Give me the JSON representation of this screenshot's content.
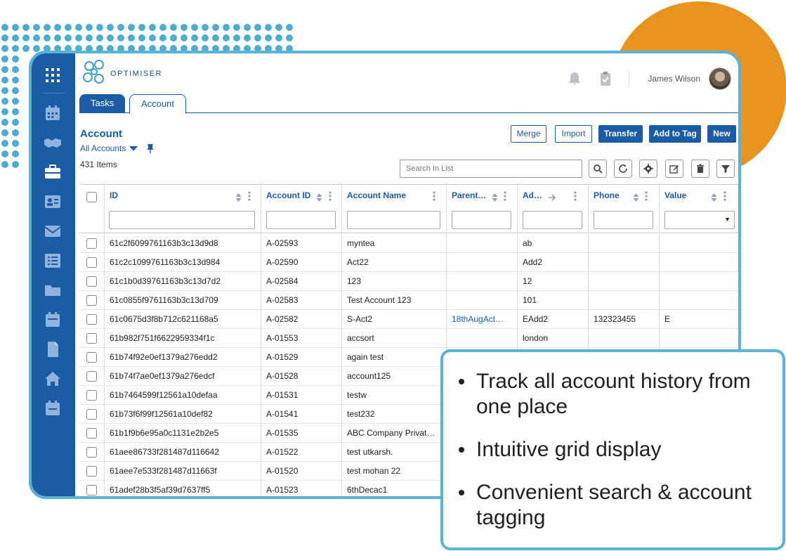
{
  "app": {
    "logo_text": "OPTIMISER",
    "user_name": "James Wilson"
  },
  "tabs": [
    {
      "label": "Tasks",
      "active": false
    },
    {
      "label": "Account",
      "active": true
    }
  ],
  "page": {
    "title": "Account",
    "view": "All Accounts",
    "item_count": "431 Items"
  },
  "actions": {
    "merge": "Merge",
    "import": "Import",
    "transfer": "Transfer",
    "add_to_tag": "Add to Tag",
    "new": "New"
  },
  "search": {
    "placeholder": "Search In List"
  },
  "toolbar_icons": [
    "search-icon",
    "refresh-icon",
    "settings-icon",
    "edit-icon",
    "delete-icon",
    "filter-icon"
  ],
  "sidebar_icons": [
    "apps-grid-icon",
    "calendar-icon",
    "handshake-icon",
    "briefcase-icon",
    "contact-card-icon",
    "mail-icon",
    "list-icon",
    "folder-icon",
    "calendar-alt-icon",
    "document-icon",
    "home-icon",
    "calendar-event-icon"
  ],
  "grid": {
    "columns": [
      "ID",
      "Account ID",
      "Account Name",
      "Parent…",
      "Ad…",
      "Phone",
      "Value"
    ],
    "rows": [
      {
        "id": "61c2f6099761163b3c13d9d8",
        "account_id": "A-02593",
        "name": "myntea",
        "parent": "",
        "address": "ab",
        "phone": "",
        "value": ""
      },
      {
        "id": "61c2c1099761163b3c13d984",
        "account_id": "A-02590",
        "name": "Act22",
        "parent": "",
        "address": "Add2",
        "phone": "",
        "value": ""
      },
      {
        "id": "61c1b0d39761163b3c13d7d2",
        "account_id": "A-02584",
        "name": "123",
        "parent": "",
        "address": "12",
        "phone": "",
        "value": ""
      },
      {
        "id": "61c0855f9761163b3c13d709",
        "account_id": "A-02583",
        "name": "Test Account 123",
        "parent": "",
        "address": "101",
        "phone": "",
        "value": ""
      },
      {
        "id": "61c0675d3f8b712c621168a5",
        "account_id": "A-02582",
        "name": "S-Act2",
        "parent": "18thAugAct…",
        "address": "EAdd2",
        "phone": "132323455",
        "value": "E"
      },
      {
        "id": "61b982f751f6622959334f1c",
        "account_id": "A-01553",
        "name": "accsort",
        "parent": "",
        "address": "london",
        "phone": "",
        "value": ""
      },
      {
        "id": "61b74f92e0ef1379a276edd2",
        "account_id": "A-01529",
        "name": "again test",
        "parent": "",
        "address": "",
        "phone": "",
        "value": ""
      },
      {
        "id": "61b74f7ae0ef1379a276edcf",
        "account_id": "A-01528",
        "name": "account125",
        "parent": "",
        "address": "",
        "phone": "",
        "value": ""
      },
      {
        "id": "61b7464599f12561a10defaa",
        "account_id": "A-01531",
        "name": "testw",
        "parent": "",
        "address": "",
        "phone": "",
        "value": ""
      },
      {
        "id": "61b73f6f99f12561a10def82",
        "account_id": "A-01541",
        "name": "test232",
        "parent": "",
        "address": "",
        "phone": "",
        "value": ""
      },
      {
        "id": "61b1f9b6e95a0c1131e2b2e5",
        "account_id": "A-01535",
        "name": "ABC Company Privat…",
        "parent": "",
        "address": "",
        "phone": "",
        "value": ""
      },
      {
        "id": "61aee86733f281487d116642",
        "account_id": "A-01522",
        "name": "test utkarsh.",
        "parent": "",
        "address": "",
        "phone": "",
        "value": ""
      },
      {
        "id": "61aee7e533f281487d11663f",
        "account_id": "A-01520",
        "name": "test mohan 22",
        "parent": "",
        "address": "",
        "phone": "",
        "value": ""
      },
      {
        "id": "61adef28b3f5af39d7637ff5",
        "account_id": "A-01523",
        "name": "6thDecac1",
        "parent": "",
        "address": "",
        "phone": "",
        "value": ""
      }
    ]
  },
  "callout": {
    "bullets": [
      "Track all account history from one place",
      "Intuitive grid display",
      "Convenient search & account tagging"
    ]
  },
  "colors": {
    "primary": "#1a5ca5",
    "frame_border": "#5ab3d4",
    "accent_orange": "#e8931e",
    "dots": "#4aaed0"
  }
}
